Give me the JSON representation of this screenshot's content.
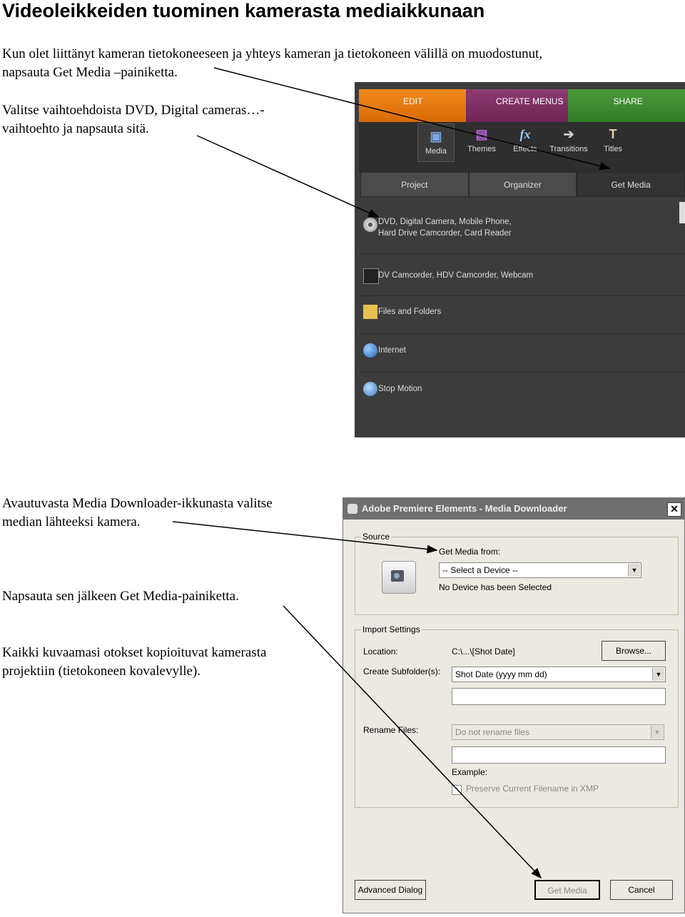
{
  "heading": "Videoleikkeiden tuominen kamerasta mediaikkunaan",
  "paragraphs": {
    "p1_line1": "Kun olet liittänyt kameran tietokoneeseen ja yhteys kameran ja tietokoneen välillä on muodostunut,",
    "p1_line2": "napsauta Get Media –painiketta.",
    "p2_line1": "Valitse vaihtoehdoista DVD, Digital cameras…-",
    "p2_line2": "vaihtoehto ja napsauta sitä.",
    "p3_line1": "Avautuvasta Media Downloader-ikkunasta valitse",
    "p3_line2": "median lähteeksi kamera.",
    "p4": "Napsauta sen jälkeen Get Media-painiketta.",
    "p5_line1": "Kaikki kuvaamasi otokset kopioituvat kamerasta",
    "p5_line2": "projektiin (tietokoneen kovalevylle)."
  },
  "premiere": {
    "tabs": [
      "EDIT",
      "CREATE MENUS",
      "SHARE"
    ],
    "tools": [
      "Media",
      "Themes",
      "Effects",
      "Transitions",
      "Titles"
    ],
    "subtabs": [
      "Project",
      "Organizer",
      "Get Media"
    ],
    "items": [
      {
        "line1": "DVD, Digital Camera, Mobile Phone,",
        "line2": "Hard Drive Camcorder, Card Reader"
      },
      {
        "line1": "DV Camcorder, HDV Camcorder, Webcam"
      },
      {
        "line1": "Files and Folders"
      },
      {
        "line1": "Internet"
      },
      {
        "line1": "Stop Motion"
      }
    ]
  },
  "downloader": {
    "title": "Adobe Premiere Elements - Media Downloader",
    "close": "✕",
    "source_legend": "Source",
    "get_media_from_label": "Get Media from:",
    "device_select": "-- Select a Device --",
    "no_device": "No Device has been Selected",
    "import_legend": "Import Settings",
    "location_label": "Location:",
    "location_value": "C:\\...\\[Shot Date]",
    "browse": "Browse...",
    "subfolder_label": "Create Subfolder(s):",
    "subfolder_value": "Shot Date (yyyy mm dd)",
    "rename_label": "Rename Files:",
    "rename_value": "Do not rename files",
    "example_label": "Example:",
    "preserve_label": "Preserve Current Filename in XMP",
    "advanced": "Advanced Dialog",
    "get_media": "Get Media",
    "cancel": "Cancel"
  }
}
